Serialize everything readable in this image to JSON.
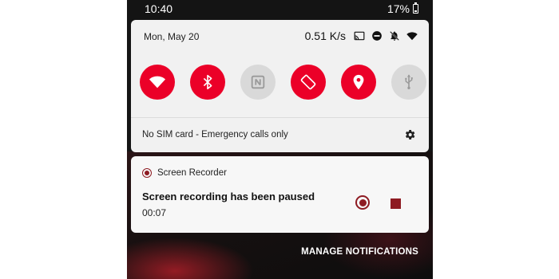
{
  "status_bar": {
    "time": "10:40",
    "battery": "17%"
  },
  "quick_settings": {
    "date": "Mon, May 20",
    "network_speed": "0.51 K/s",
    "tiles": [
      {
        "name": "wifi",
        "state": "on"
      },
      {
        "name": "bluetooth",
        "state": "on"
      },
      {
        "name": "nfc",
        "state": "off"
      },
      {
        "name": "auto-rotate",
        "state": "on"
      },
      {
        "name": "location",
        "state": "on"
      },
      {
        "name": "usb",
        "state": "off"
      }
    ],
    "sim_status": "No SIM card - Emergency calls only"
  },
  "notification": {
    "app_name": "Screen Recorder",
    "title": "Screen recording has been paused",
    "elapsed": "00:07"
  },
  "footer": {
    "manage_label": "MANAGE NOTIFICATIONS"
  },
  "colors": {
    "accent": "#eb0028",
    "tile_off": "#d9d9d9",
    "recorder": "#8e1b22"
  }
}
